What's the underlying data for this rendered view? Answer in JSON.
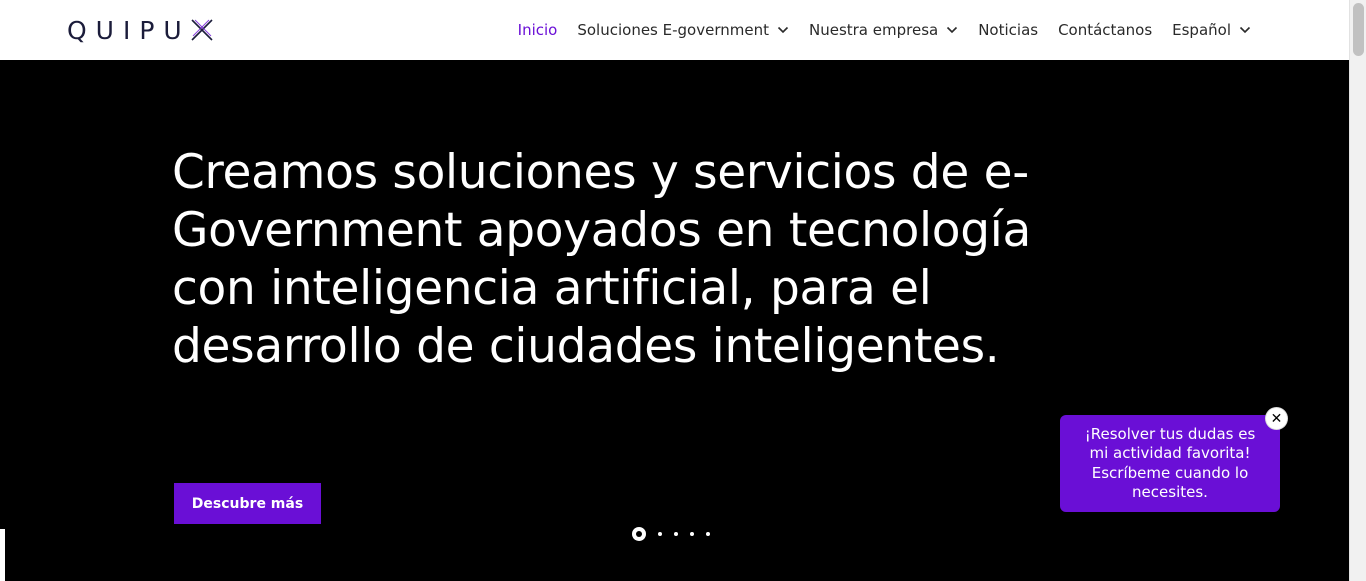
{
  "header": {
    "logo_text": "QUIPU",
    "nav": [
      {
        "label": "Inicio",
        "active": true,
        "dropdown": false
      },
      {
        "label": "Soluciones E-government",
        "active": false,
        "dropdown": true
      },
      {
        "label": "Nuestra empresa",
        "active": false,
        "dropdown": true
      },
      {
        "label": "Noticias",
        "active": false,
        "dropdown": false
      },
      {
        "label": "Contáctanos",
        "active": false,
        "dropdown": false
      },
      {
        "label": "Español",
        "active": false,
        "dropdown": true
      }
    ]
  },
  "hero": {
    "title": "Creamos soluciones y servicios de e-Government apoyados en tecnología con inteligencia artificial, para el desarrollo de ciudades inteligentes.",
    "cta_label": "Descubre más",
    "slides_total": 5,
    "active_slide": 1
  },
  "chat": {
    "message": "¡Resolver tus dudas es mi actividad favorita! Escríbeme cuando lo necesites.",
    "close_glyph": "✕"
  },
  "colors": {
    "accent": "#6a0fd6",
    "hero_bg": "#000000",
    "logo": "#1b1c3a"
  },
  "icons": {
    "dropdown": "chevron-down-icon",
    "logo_mark": "x-logo-icon",
    "close": "close-icon"
  }
}
